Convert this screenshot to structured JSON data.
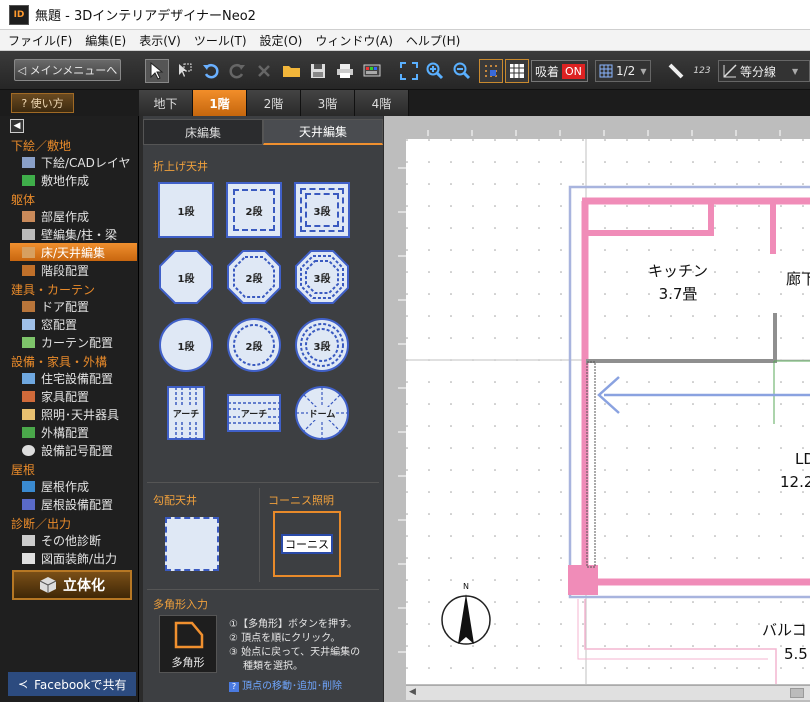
{
  "window": {
    "title": "無題 - 3Dインテリアデザイナー​Neo2",
    "app_icon": "ID"
  },
  "menu": [
    "ファイル(F)",
    "編集(E)",
    "表示(V)",
    "ツール(T)",
    "設定(O)",
    "ウィンドウ(A)",
    "ヘルプ(H)"
  ],
  "toolbar": {
    "main_menu": "◁ メインメニューへ",
    "snap_label": "吸着",
    "snap_state": "ON",
    "grid_value": "1/2",
    "numbering": "123",
    "measure_value": "等分線"
  },
  "help_button": "? 使い方",
  "floor_tabs": [
    "地下",
    "1階",
    "2階",
    "3階",
    "4階"
  ],
  "active_floor": "1階",
  "sidebar": {
    "categories": {
      "site": "下絵／敷地",
      "structure": "躯体",
      "fittings": "建具・カーテン",
      "equipment": "設備・家具・外構",
      "roof": "屋根",
      "diagnosis": "診断／出力"
    },
    "items": {
      "underlay": "下絵/CADレイヤ",
      "site": "敷地作成",
      "room": "部屋作成",
      "wall": "壁編集/柱・梁",
      "floor_ceiling": "床/天井編集",
      "stairs": "階段配置",
      "door": "ドア配置",
      "window": "窓配置",
      "curtain": "カーテン配置",
      "housing_equipment": "住宅設備配置",
      "furniture": "家具配置",
      "lighting": "照明･天井器具",
      "exterior": "外構配置",
      "equipment_symbol": "設備記号配置",
      "roof_create": "屋根作成",
      "roof_equipment": "屋根設備配置",
      "other_diagnosis": "その他診断",
      "drawing_output": "図面装飾/出力"
    },
    "render_button": "立体化",
    "facebook_button": "Facebookで共有"
  },
  "panel": {
    "tabs": [
      "床編集",
      "天井編集"
    ],
    "active_tab": "天井編集",
    "folded_ceiling_label": "折上げ天井",
    "tiles": [
      "1段",
      "2段",
      "3段",
      "1段",
      "2段",
      "3段",
      "1段",
      "2段",
      "3段",
      "アーチ",
      "アーチ",
      "ドーム"
    ],
    "slope_ceiling_label": "勾配天井",
    "cornice_label": "コーニス照明",
    "cornice_tile": "コーニス",
    "polygon_label": "多角形入力",
    "polygon_button": "多角形",
    "instructions": [
      "①【多角形】ボタンを押す。",
      "② 頂点を順にクリック。",
      "③ 始点に戻って、天井編集の",
      "種類を選択。"
    ],
    "instructions_link": "頂点の移動･追加･削除"
  },
  "plan": {
    "rooms": [
      {
        "name": "キッチン",
        "size": "3.7畳"
      },
      {
        "name": "廊下",
        "size": ""
      },
      {
        "name": "LD",
        "size": "12.2"
      },
      {
        "name": "バルコ",
        "size": "5.5"
      }
    ]
  },
  "colors": {
    "accent": "#f0902f",
    "wall": "#f08cb8",
    "outline": "#a8b4de",
    "arrow": "#8aa2e0",
    "snap_on": "#dd2222"
  }
}
